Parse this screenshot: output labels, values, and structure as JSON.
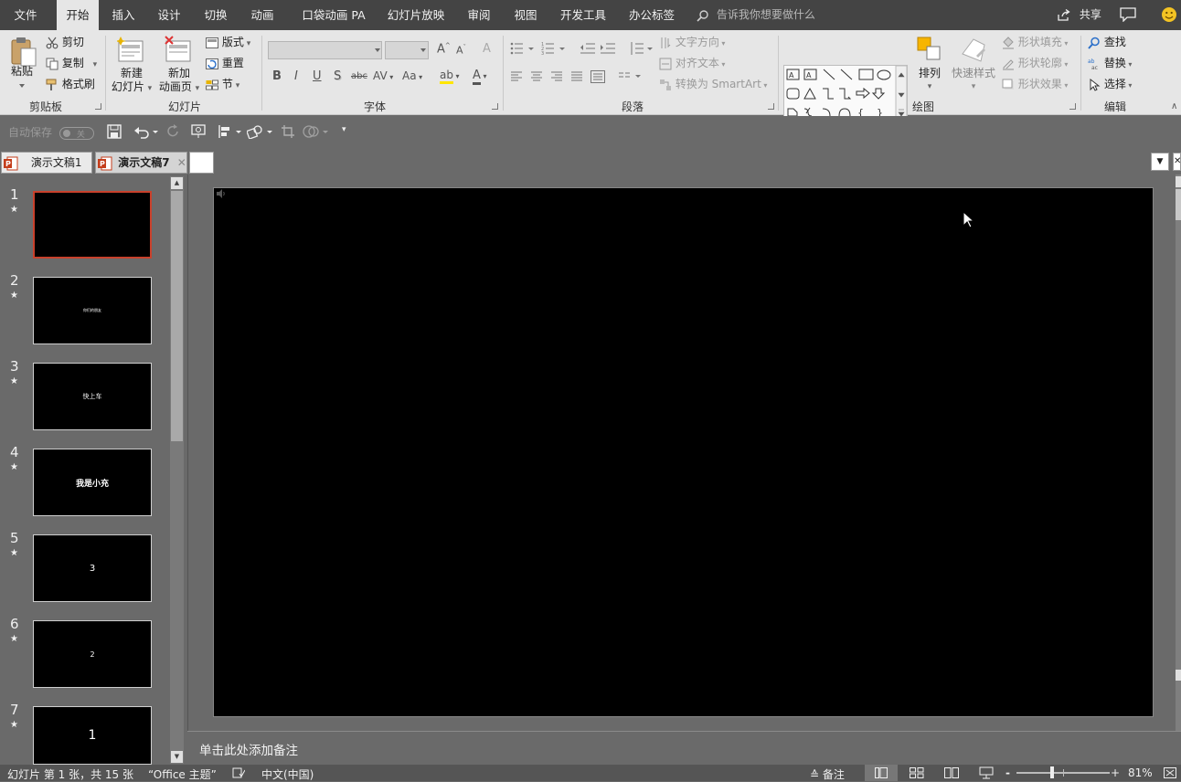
{
  "ribbon_tabs": [
    "文件",
    "开始",
    "插入",
    "设计",
    "切换",
    "动画",
    "口袋动画 PA",
    "幻灯片放映",
    "审阅",
    "视图",
    "开发工具",
    "办公标签"
  ],
  "active_tab": "开始",
  "tell_me": "告诉我你想要做什么",
  "share": "共享",
  "clipboard": {
    "paste": "粘贴",
    "cut": "剪切",
    "copy": "复制",
    "format_painter": "格式刷",
    "group": "剪贴板"
  },
  "slides_group": {
    "new_slide_1": "新建",
    "new_slide_2": "幻灯片",
    "new_anim_1": "新加",
    "new_anim_2": "动画页",
    "layout": "版式",
    "reset": "重置",
    "section": "节",
    "group": "幻灯片"
  },
  "font_group": {
    "group": "字体",
    "bold": "B",
    "italic": "I",
    "underline": "U",
    "shadow": "S",
    "strike": "abc",
    "spacing": "AV",
    "case": "Aa",
    "color": "A"
  },
  "paragraph_group": {
    "text_direction": "文字方向",
    "align_text": "对齐文本",
    "smartart": "转换为 SmartArt",
    "group": "段落"
  },
  "drawing_group": {
    "arrange": "排列",
    "quick_styles": "快速样式",
    "shape_fill": "形状填充",
    "shape_outline": "形状轮廓",
    "shape_effects": "形状效果",
    "group": "绘图"
  },
  "editing_group": {
    "find": "查找",
    "replace": "替换",
    "select": "选择",
    "group": "编辑"
  },
  "qat": {
    "autosave": "自动保存",
    "autosave_state": "关"
  },
  "doc_tabs": [
    "演示文稿1",
    "演示文稿7"
  ],
  "thumbnails": [
    {
      "num": "1",
      "text": ""
    },
    {
      "num": "2",
      "text": "你们的朋友"
    },
    {
      "num": "3",
      "text": "快上车"
    },
    {
      "num": "4",
      "text": "我是小充"
    },
    {
      "num": "5",
      "text": "3"
    },
    {
      "num": "6",
      "text": "2"
    },
    {
      "num": "7",
      "text": "1"
    }
  ],
  "notes_placeholder": "单击此处添加备注",
  "status": {
    "slide_info": "幻灯片 第 1 张，共 15 张",
    "theme": "“Office 主题”",
    "language": "中文(中国)",
    "notes": "备注",
    "zoom": "81%"
  },
  "colors": {
    "tabbar": "#444444",
    "ribbon": "#e6e6e6",
    "workspace": "#6a6a6a",
    "selected_border": "#c9412c",
    "slide_bg": "#000000"
  }
}
